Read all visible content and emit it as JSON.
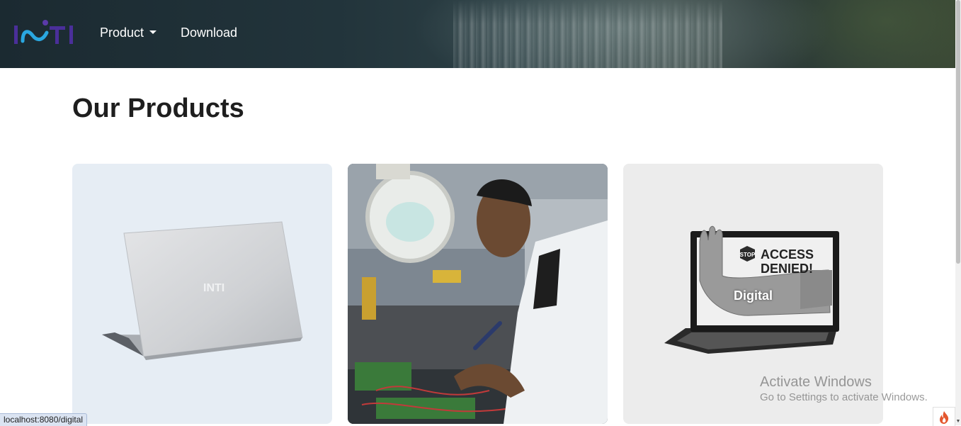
{
  "header": {
    "logo_text": "INTI",
    "nav": {
      "product_label": "Product",
      "download_label": "Download"
    }
  },
  "main": {
    "title": "Our Products",
    "cards": [
      {
        "caption": ""
      },
      {
        "caption": ""
      },
      {
        "caption": "Digital",
        "screen_text": [
          "STOP",
          "ACCESS",
          "DENIED!"
        ]
      }
    ]
  },
  "overlay": {
    "activate_title": "Activate Windows",
    "activate_sub": "Go to Settings to activate Windows."
  },
  "status_bar": {
    "url": "localhost:8080/digital"
  },
  "icons": [
    "chevron-down-icon",
    "flame-icon",
    "scroll-down-icon"
  ],
  "colors": {
    "logo_blue": "#2aa7e0",
    "logo_purple": "#5b3aa8",
    "title": "#1e1e1e",
    "card_bg_1": "#e6edf4",
    "card_bg_3": "#ececec"
  }
}
